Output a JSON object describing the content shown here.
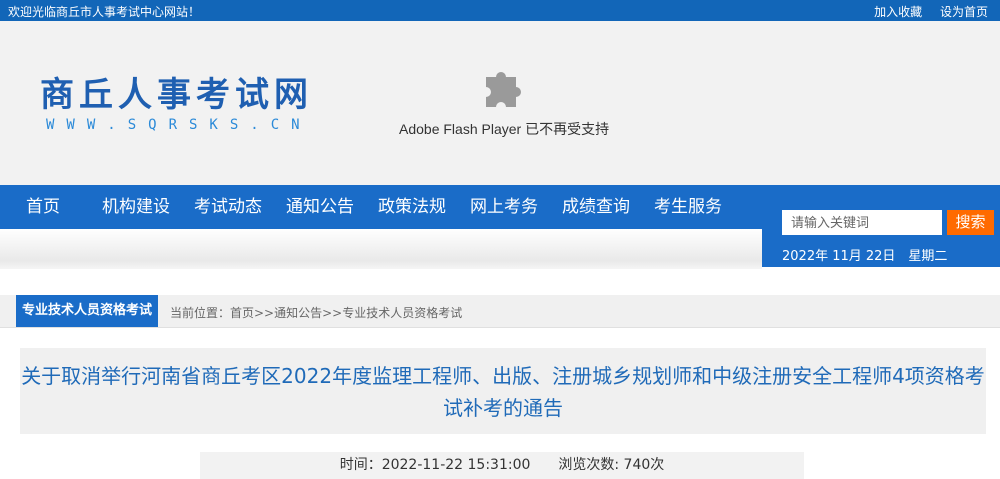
{
  "topbar": {
    "welcome": "欢迎光临商丘市人事考试中心网站！",
    "add_favorite": "加入收藏",
    "set_homepage": "设为首页"
  },
  "header": {
    "logo_text": "商丘人事考试网",
    "logo_url": "WWW.SQRSKS.CN",
    "flash_notice": "Adobe Flash Player 已不再受支持"
  },
  "nav": {
    "items": [
      "首页",
      "机构建设",
      "考试动态",
      "通知公告",
      "政策法规",
      "网上考务",
      "成绩查询",
      "考生服务"
    ]
  },
  "search": {
    "placeholder": "请输入关键词",
    "button": "搜索",
    "date": "2022年 11月 22日　星期二"
  },
  "location": {
    "category": "专业技术人员资格考试",
    "breadcrumb": "当前位置：首页>>通知公告>>专业技术人员资格考试"
  },
  "article": {
    "title_line1": "关于取消举行河南省商丘考区2022年度监理工程师、出版、注册城乡规划师和中级注册安全工程师4项资格考",
    "title_line2": "试补考的通告",
    "meta": "时间：2022-11-22 15:31:00　　浏览次数: 740次"
  },
  "colors": {
    "primary": "#1a6cc8",
    "accent": "#ff6a00",
    "title": "#1f6ab8"
  }
}
